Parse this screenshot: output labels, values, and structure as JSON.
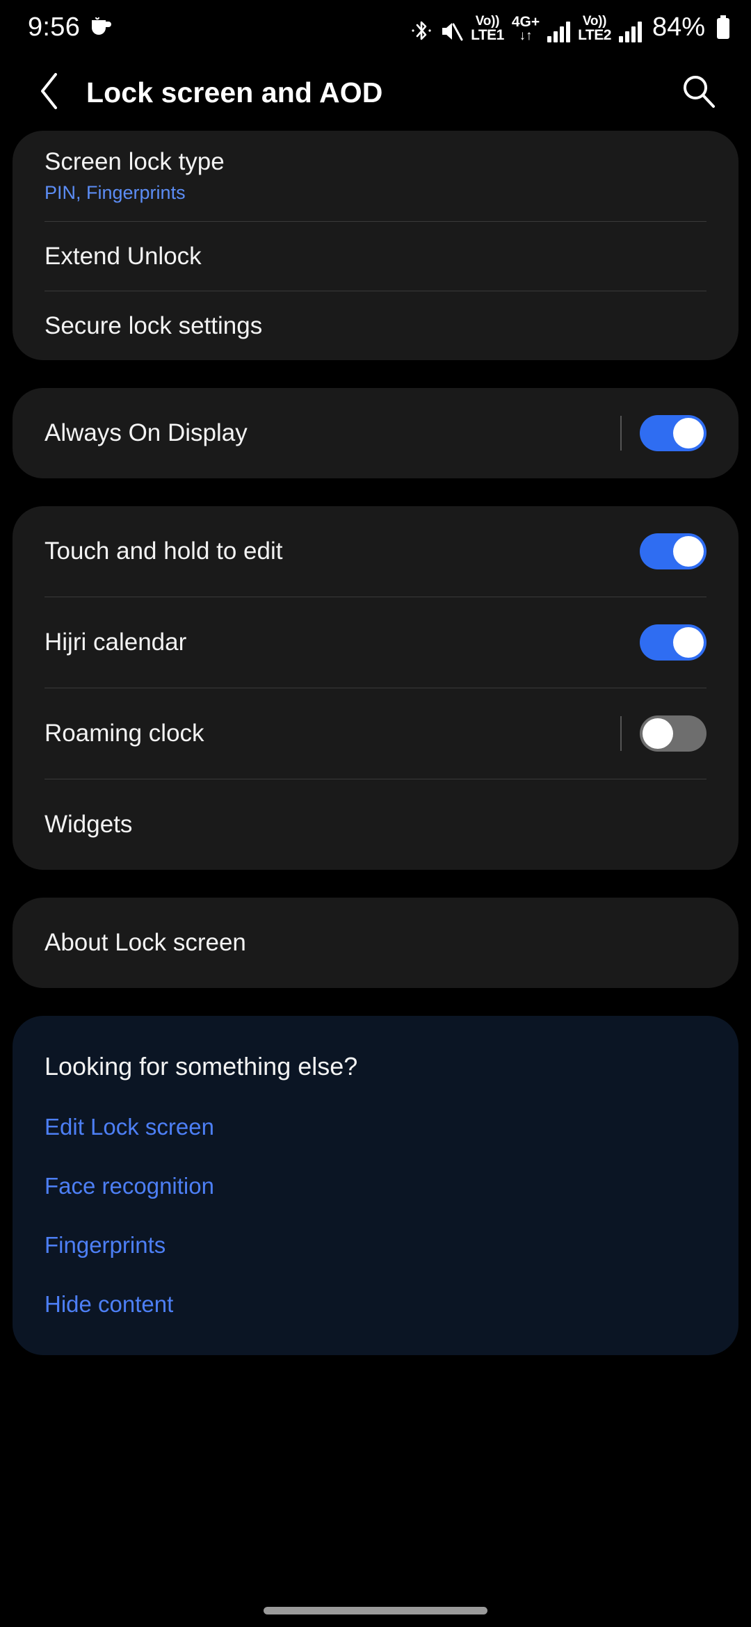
{
  "status_bar": {
    "time": "9:56",
    "coffee_icon": "coffee-cup-icon",
    "bluetooth_icon": "bluetooth-icon",
    "mute_icon": "volume-mute-icon",
    "sim1": {
      "volte_top": "Vo))",
      "volte_bottom": "LTE1",
      "net_top": "4G+",
      "net_bottom": "↓↑"
    },
    "sim2": {
      "volte_top": "Vo))",
      "volte_bottom": "LTE2"
    },
    "battery_percent": "84%",
    "battery_icon": "battery-icon"
  },
  "app_bar": {
    "back_icon": "back-chevron-icon",
    "title": "Lock screen and AOD",
    "search_icon": "search-icon"
  },
  "cards": {
    "security": [
      {
        "label": "Screen lock type",
        "sub": "PIN, Fingerprints"
      },
      {
        "label": "Extend Unlock"
      },
      {
        "label": "Secure lock settings"
      }
    ],
    "aod": {
      "label": "Always On Display",
      "switch_state": "on"
    },
    "lockscreen_options": [
      {
        "label": "Touch and hold to edit",
        "switch_state": "on"
      },
      {
        "label": "Hijri calendar",
        "switch_state": "on"
      },
      {
        "label": "Roaming clock",
        "switch_state": "off"
      },
      {
        "label": "Widgets"
      }
    ],
    "about": {
      "label": "About Lock screen"
    }
  },
  "footer": {
    "title": "Looking for something else?",
    "links": [
      "Edit Lock screen",
      "Face recognition",
      "Fingerprints",
      "Hide content"
    ]
  },
  "colors": {
    "accent_blue": "#2f6df2",
    "link_blue": "#4d7ff5",
    "card_bg": "#1a1a1a",
    "footer_bg": "#0b1524",
    "page_bg": "#000000",
    "switch_off": "#6e6e6e"
  }
}
